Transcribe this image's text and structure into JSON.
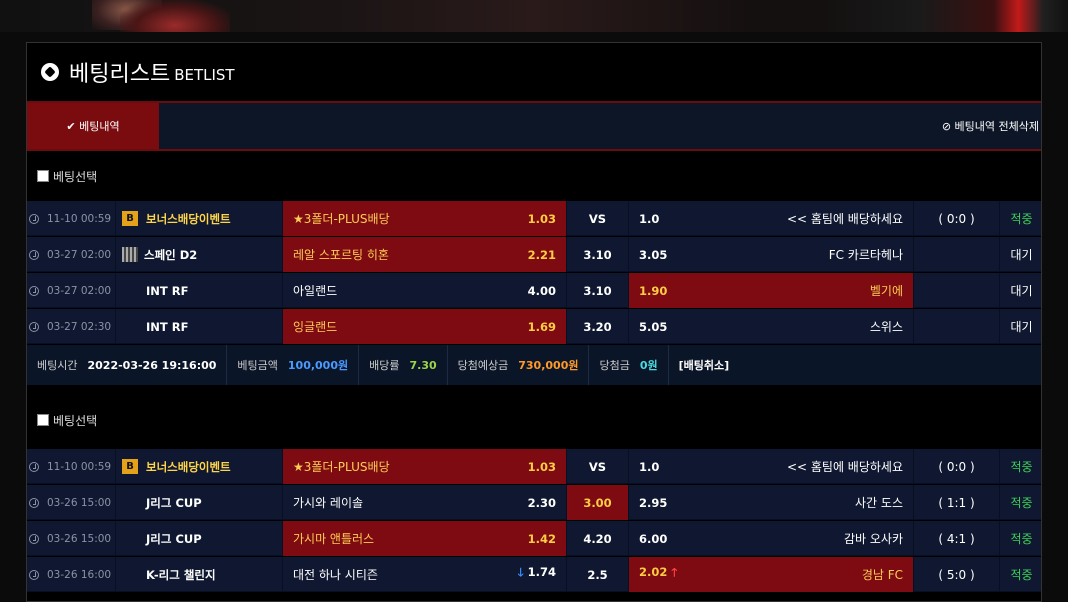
{
  "header": {
    "title_ko": "베팅리스트",
    "title_en": "BETLIST"
  },
  "tabs": {
    "active": "✔ 베팅내역",
    "delete_all": "⊘ 베팅내역 전체삭제"
  },
  "slips": [
    {
      "select_label": "베팅선택",
      "rows": [
        {
          "time": "11-10 00:59",
          "league": "보너스배당이벤트",
          "league_icon": "bonus-icon",
          "home": "★3폴더-PLUS배당",
          "home_odds": "1.03",
          "draw": "VS",
          "away": "<< 홈팀에 배당하세요",
          "away_odds": "1.0",
          "score": "( 0:0 )",
          "status": "적중",
          "pick": "home"
        },
        {
          "time": "03-27 02:00",
          "league": "스페인 D2",
          "league_icon": "flag-icon",
          "home": "레알 스포르팅 히혼",
          "home_odds": "2.21",
          "draw": "3.10",
          "away": "FC 카르타헤나",
          "away_odds": "3.05",
          "score": "",
          "status": "대기",
          "pick": "home"
        },
        {
          "time": "03-27 02:00",
          "league": "INT RF",
          "league_icon": "",
          "home": "아일랜드",
          "home_odds": "4.00",
          "draw": "3.10",
          "away": "벨기에",
          "away_odds": "1.90",
          "score": "",
          "status": "대기",
          "pick": "away"
        },
        {
          "time": "03-27 02:30",
          "league": "INT RF",
          "league_icon": "",
          "home": "잉글랜드",
          "home_odds": "1.69",
          "draw": "3.20",
          "away": "스위스",
          "away_odds": "5.05",
          "score": "",
          "status": "대기",
          "pick": "home"
        }
      ],
      "summary": {
        "bet_time_label": "베팅시간",
        "bet_time": "2022-03-26 19:16:00",
        "amount_label": "베팅금액",
        "amount": "100,000원",
        "odds_label": "배당률",
        "odds": "7.30",
        "expected_label": "당첨예상금",
        "expected": "730,000원",
        "won_label": "당첨금",
        "won": "0원",
        "cancel": "[배팅취소]"
      }
    },
    {
      "select_label": "베팅선택",
      "rows": [
        {
          "time": "11-10 00:59",
          "league": "보너스배당이벤트",
          "league_icon": "bonus-icon",
          "home": "★3폴더-PLUS배당",
          "home_odds": "1.03",
          "draw": "VS",
          "away": "<< 홈팀에 배당하세요",
          "away_odds": "1.0",
          "score": "( 0:0 )",
          "status": "적중",
          "pick": "home"
        },
        {
          "time": "03-26 15:00",
          "league": "J리그 CUP",
          "league_icon": "",
          "home": "가시와 레이솔",
          "home_odds": "2.30",
          "draw": "3.00",
          "away": "사간 도스",
          "away_odds": "2.95",
          "score": "( 1:1 )",
          "status": "적중",
          "pick": "draw"
        },
        {
          "time": "03-26 15:00",
          "league": "J리그 CUP",
          "league_icon": "",
          "home": "가시마 앤틀러스",
          "home_odds": "1.42",
          "draw": "4.20",
          "away": "감바 오사카",
          "away_odds": "6.00",
          "score": "( 4:1 )",
          "status": "적중",
          "pick": "home"
        },
        {
          "time": "03-26 16:00",
          "league": "K-리그 챌린지",
          "league_icon": "",
          "home": "대전 하나 시티즌",
          "home_odds": "1.74",
          "draw": "2.5",
          "away": "경남 FC",
          "away_odds": "2.02",
          "score": "( 5:0 )",
          "status": "적중",
          "pick": "away",
          "home_arrow": "down",
          "away_arrow": "up"
        }
      ]
    }
  ]
}
